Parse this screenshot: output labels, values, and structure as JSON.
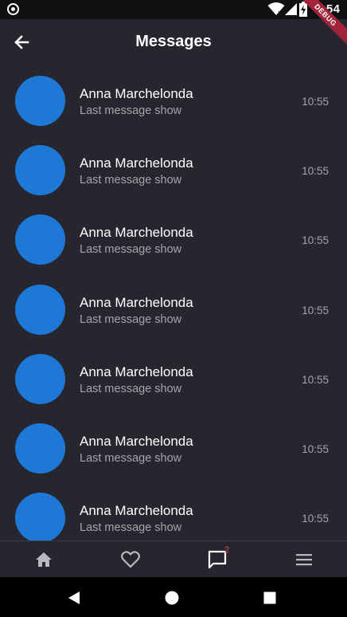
{
  "status_bar": {
    "time": "5:54",
    "icons": [
      "record-icon",
      "wifi-icon",
      "signal-icon",
      "battery-charging-icon"
    ]
  },
  "debug_banner": "DEBUG",
  "app_bar": {
    "title": "Messages",
    "back_icon": "arrow-back-icon"
  },
  "messages": [
    {
      "name": "Anna Marchelonda",
      "preview": "Last message show",
      "time": "10:55"
    },
    {
      "name": "Anna Marchelonda",
      "preview": "Last message show",
      "time": "10:55"
    },
    {
      "name": "Anna Marchelonda",
      "preview": "Last message show",
      "time": "10:55"
    },
    {
      "name": "Anna Marchelonda",
      "preview": "Last message show",
      "time": "10:55"
    },
    {
      "name": "Anna Marchelonda",
      "preview": "Last message show",
      "time": "10:55"
    },
    {
      "name": "Anna Marchelonda",
      "preview": "Last message show",
      "time": "10:55"
    },
    {
      "name": "Anna Marchelonda",
      "preview": "Last message show",
      "time": "10:55"
    }
  ],
  "bottom_nav": {
    "items": [
      {
        "icon": "home-icon"
      },
      {
        "icon": "heart-icon"
      },
      {
        "icon": "chat-icon",
        "badge": "2"
      },
      {
        "icon": "menu-icon"
      }
    ]
  },
  "system_nav": [
    "back-triangle-icon",
    "home-circle-icon",
    "recents-square-icon"
  ],
  "colors": {
    "background": "#26262e",
    "avatar": "#1e78d6",
    "text_primary": "#ffffff",
    "text_secondary": "#a4a4ab",
    "badge": "#e84a4a",
    "debug_banner": "#a3243a"
  }
}
